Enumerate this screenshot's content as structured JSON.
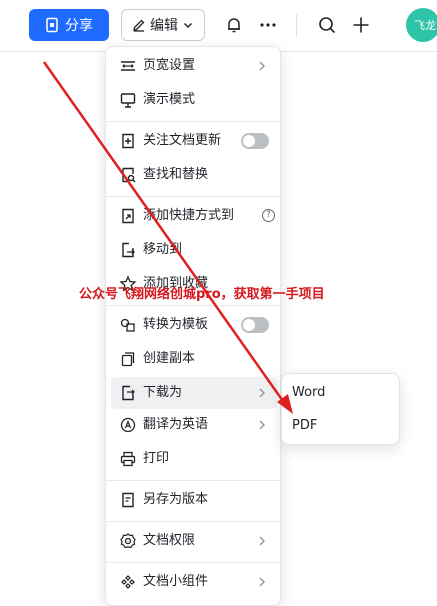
{
  "toolbar": {
    "share_label": "分享",
    "edit_label": "编辑",
    "avatar_text": "飞龙"
  },
  "menu": {
    "items": [
      {
        "label": "页宽设置",
        "icon": "page-width-icon"
      },
      {
        "label": "演示模式",
        "icon": "presentation-icon"
      },
      {
        "label": "关注文档更新",
        "icon": "follow-icon"
      },
      {
        "label": "查找和替换",
        "icon": "find-replace-icon"
      },
      {
        "label": "添加快捷方式到",
        "icon": "shortcut-icon"
      },
      {
        "label": "移动到",
        "icon": "move-icon"
      },
      {
        "label": "添加到收藏",
        "icon": "star-icon"
      },
      {
        "label": "转换为模板",
        "icon": "template-icon"
      },
      {
        "label": "创建副本",
        "icon": "copy-icon"
      },
      {
        "label": "下载为",
        "icon": "download-icon"
      },
      {
        "label": "翻译为英语",
        "icon": "translate-icon"
      },
      {
        "label": "打印",
        "icon": "print-icon"
      },
      {
        "label": "另存为版本",
        "icon": "version-icon"
      },
      {
        "label": "文档权限",
        "icon": "gear-icon"
      },
      {
        "label": "文档小组件",
        "icon": "widget-icon"
      }
    ]
  },
  "submenu": {
    "items": [
      "Word",
      "PDF"
    ]
  },
  "watermark": "公众号飞翔网络创城pro，获取第一手项目",
  "colors": {
    "primary": "#1f6bff",
    "avatar": "#2ec4a8",
    "annotation": "#d4181d"
  }
}
